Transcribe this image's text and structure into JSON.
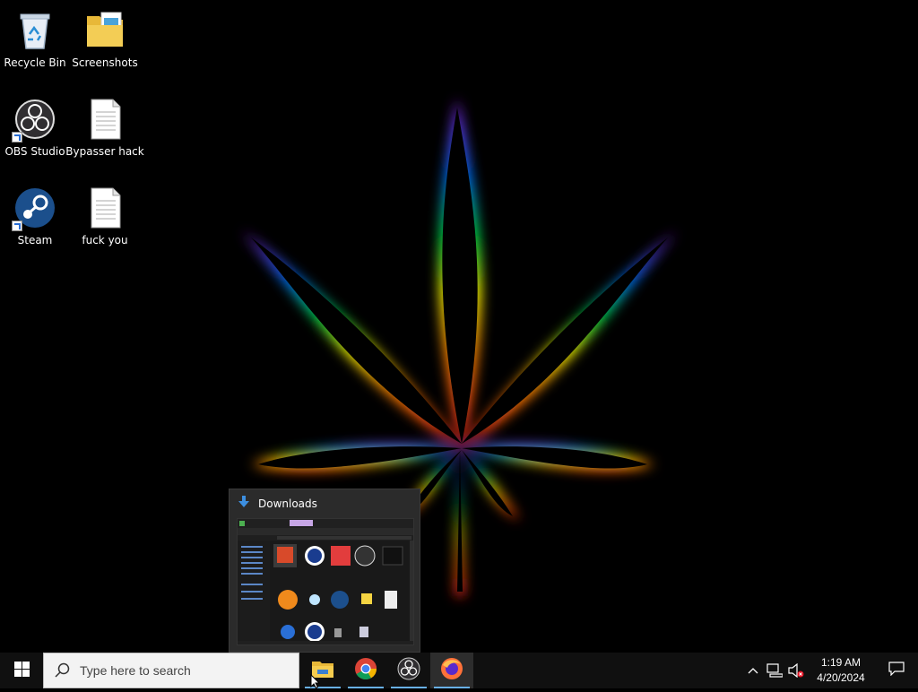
{
  "desktop_icons": [
    {
      "label": "Recycle Bin",
      "icon": "recycle-bin-icon"
    },
    {
      "label": "Screenshots",
      "icon": "folder-icon"
    },
    {
      "label": "OBS Studio",
      "icon": "obs-icon",
      "shortcut": true
    },
    {
      "label": "Bypasser hack",
      "icon": "text-file-icon"
    },
    {
      "label": "Steam",
      "icon": "steam-icon",
      "shortcut": true
    },
    {
      "label": "fuck you",
      "icon": "text-file-icon"
    }
  ],
  "thumbnail": {
    "title": "Downloads"
  },
  "taskbar": {
    "search_placeholder": "Type here to search",
    "apps": [
      {
        "name": "File Explorer",
        "icon": "file-explorer-icon",
        "running": true
      },
      {
        "name": "Google Chrome",
        "icon": "chrome-icon",
        "running": true
      },
      {
        "name": "OBS Studio",
        "icon": "obs-icon",
        "running": true
      },
      {
        "name": "Firefox",
        "icon": "firefox-icon",
        "running": true,
        "active": true
      }
    ],
    "clock": {
      "time": "1:19 AM",
      "date": "4/20/2024"
    }
  },
  "colors": {
    "taskbar_bg": "#101010",
    "desktop_bg": "#000000",
    "running_indicator": "#68b0e8"
  }
}
